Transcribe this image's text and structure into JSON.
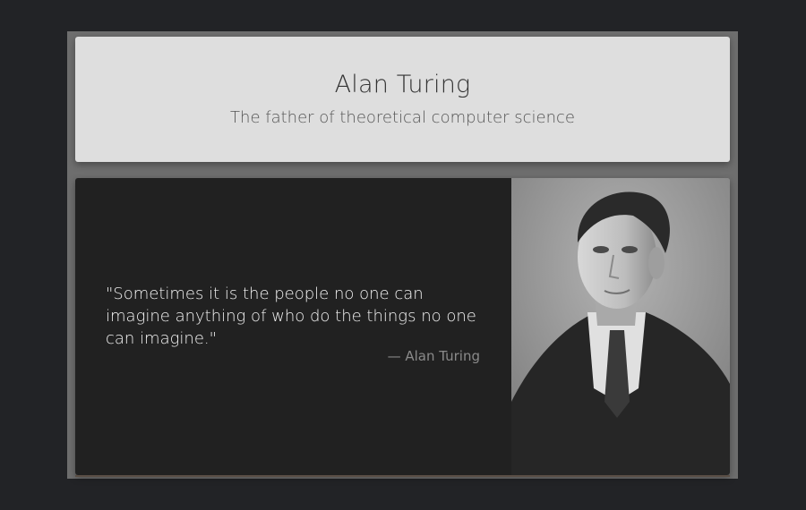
{
  "header": {
    "title": "Alan Turing",
    "subtitle": "The father of theoretical computer science"
  },
  "quote": {
    "text": "\"Sometimes it is the people no one can imagine anything of who do the things no one can imagine.\"",
    "author": "— Alan Turing"
  },
  "portrait": {
    "subject": "Alan Turing portrait",
    "style": "black-and-white photograph"
  },
  "colors": {
    "page_bg": "#222326",
    "frame_bg": "#6e6e6e",
    "header_bg": "#dedede",
    "quote_bg": "#212121"
  }
}
